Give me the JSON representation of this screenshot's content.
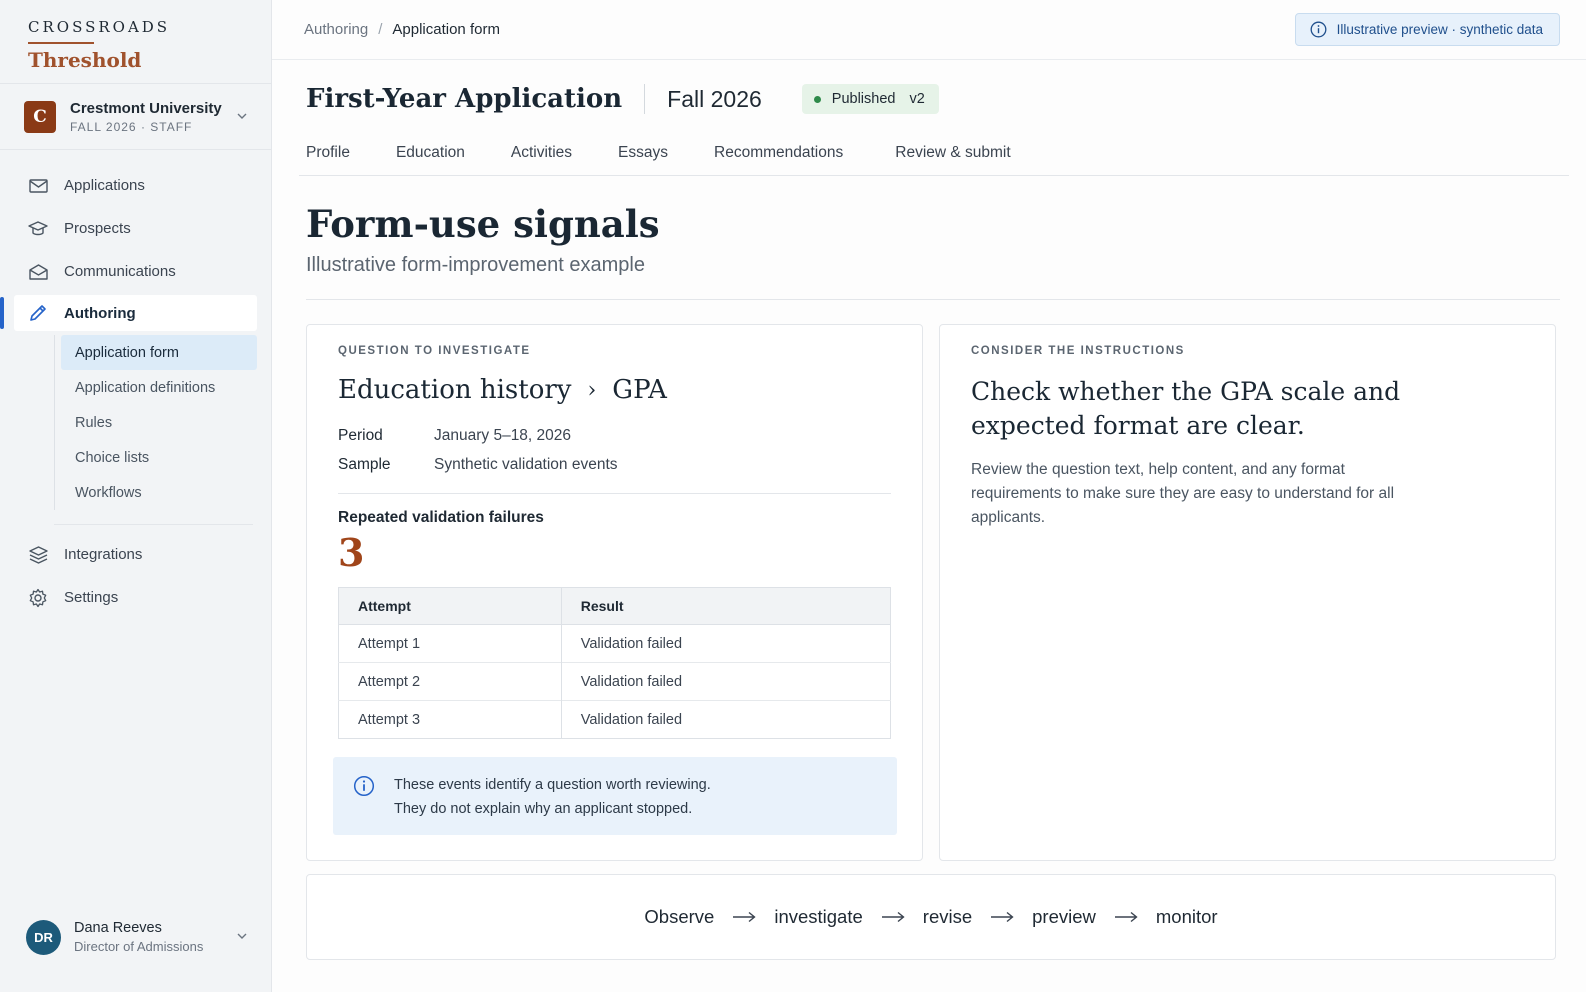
{
  "brand": {
    "top": "CROSSROADS",
    "name": "Threshold"
  },
  "org": {
    "initial": "C",
    "name": "Crestmont University",
    "sub": "FALL 2026  ·  STAFF"
  },
  "nav": {
    "applications": "Applications",
    "prospects": "Prospects",
    "communications": "Communications",
    "authoring": "Authoring",
    "sub": [
      "Application form",
      "Application definitions",
      "Rules",
      "Choice lists",
      "Workflows"
    ],
    "integrations": "Integrations",
    "settings": "Settings"
  },
  "user": {
    "initials": "DR",
    "name": "Dana Reeves",
    "role": "Director of Admissions"
  },
  "breadcrumb": {
    "parent": "Authoring",
    "sep": "/",
    "current": "Application form"
  },
  "preview_badge": "Illustrative preview · synthetic data",
  "header": {
    "title": "First-Year Application",
    "term": "Fall 2026",
    "status": "Published",
    "version": "v2"
  },
  "tabs": [
    "Profile",
    "Education",
    "Activities",
    "Essays",
    "Recommendations",
    "Review & submit"
  ],
  "page": {
    "title": "Form-use signals",
    "subtitle": "Illustrative form-improvement example"
  },
  "question": {
    "eyebrow": "QUESTION TO INVESTIGATE",
    "section": "Education history",
    "separator": "›",
    "field": "GPA",
    "period_label": "Period",
    "period_value": "January 5–18, 2026",
    "sample_label": "Sample",
    "sample_value": "Synthetic validation events",
    "failures_label": "Repeated validation failures",
    "failures_count": "3",
    "table": {
      "headers": [
        "Attempt",
        "Result"
      ],
      "rows": [
        [
          "Attempt 1",
          "Validation failed"
        ],
        [
          "Attempt 2",
          "Validation failed"
        ],
        [
          "Attempt 3",
          "Validation failed"
        ]
      ]
    },
    "note_line1": "These events identify a question worth reviewing.",
    "note_line2": "They do not explain why an applicant stopped."
  },
  "instructions": {
    "eyebrow": "CONSIDER THE INSTRUCTIONS",
    "title": "Check whether the GPA scale and expected format are clear.",
    "body": "Review the question text, help content, and any format requirements to make sure they are easy to understand for all applicants."
  },
  "flow": [
    "Observe",
    "investigate",
    "revise",
    "preview",
    "monitor"
  ],
  "colors": {
    "accent": "#2563c9",
    "brand": "#a0522d",
    "count": "#a0451a",
    "published_dot": "#2f8a4a"
  }
}
